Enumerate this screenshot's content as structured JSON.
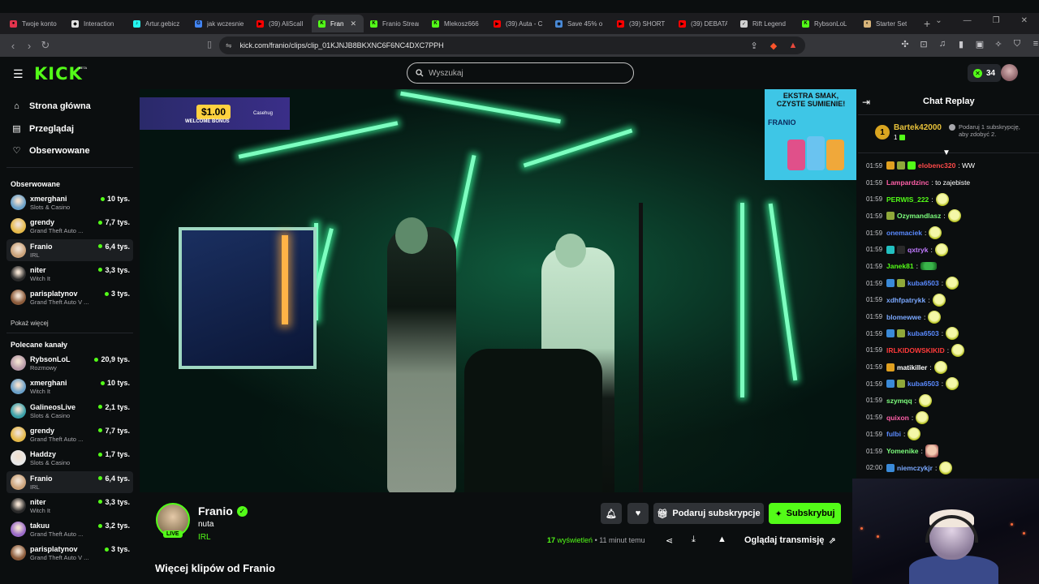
{
  "tabs": [
    {
      "title": "Twoje konto",
      "color": "#e2344d",
      "glyph": "●",
      "active": false
    },
    {
      "title": "Interaction",
      "color": "#e0e0e0",
      "glyph": "◆",
      "active": false
    },
    {
      "title": "Artur.gebicz",
      "color": "#25f4ee",
      "glyph": "♪",
      "active": false
    },
    {
      "title": "jak wczesnie",
      "color": "#4285f4",
      "glyph": "G",
      "active": false
    },
    {
      "title": "(39) AliScall",
      "color": "#ff0000",
      "glyph": "▶",
      "active": false
    },
    {
      "title": "Fran",
      "color": "#53fc18",
      "glyph": "K",
      "active": true
    },
    {
      "title": "Franio Stream",
      "color": "#53fc18",
      "glyph": "K",
      "active": false
    },
    {
      "title": "Mlekosz666",
      "color": "#53fc18",
      "glyph": "K",
      "active": false
    },
    {
      "title": "(39) Auta - C",
      "color": "#ff0000",
      "glyph": "▶",
      "active": false
    },
    {
      "title": "Save 45% o",
      "color": "#4a8ad8",
      "glyph": "◉",
      "active": false
    },
    {
      "title": "(39) SHORT",
      "color": "#ff0000",
      "glyph": "▶",
      "active": false
    },
    {
      "title": "(39) DEBATA",
      "color": "#ff0000",
      "glyph": "▶",
      "active": false
    },
    {
      "title": "Rift Legend",
      "color": "#d0d0d0",
      "glyph": "✓",
      "active": false
    },
    {
      "title": "RybsonLoL",
      "color": "#53fc18",
      "glyph": "K",
      "active": false
    },
    {
      "title": "Starter Set",
      "color": "#d7b47a",
      "glyph": "◐",
      "active": false
    }
  ],
  "address_bar": {
    "url": "kick.com/franio/clips/clip_01KJNJB8BKXNC6F6NC4DXC7PPH"
  },
  "header": {
    "logo": "KICK",
    "logo_badge": "BETA",
    "search_placeholder": "Wyszukaj",
    "kicks_count": "34"
  },
  "sidebar": {
    "nav": [
      {
        "label": "Strona główna",
        "icon": "home-icon"
      },
      {
        "label": "Przeglądaj",
        "icon": "browse-icon"
      },
      {
        "label": "Obserwowane",
        "icon": "heart-icon"
      }
    ],
    "followed_heading": "Obserwowane",
    "followed": [
      {
        "name": "xmerghani",
        "category": "Slots & Casino",
        "viewers": "10 tys.",
        "avatar": "#6aa0c8",
        "selected": false
      },
      {
        "name": "grendy",
        "category": "Grand Theft Auto ...",
        "viewers": "7,7 tys.",
        "avatar": "#e5b94a",
        "selected": false
      },
      {
        "name": "Franio",
        "category": "IRL",
        "viewers": "6,4 tys.",
        "avatar": "#caa27a",
        "selected": true
      },
      {
        "name": "niter",
        "category": "Witch It",
        "viewers": "3,3 tys.",
        "avatar": "#2a2a2a",
        "selected": false
      },
      {
        "name": "parisplatynov",
        "category": "Grand Theft Auto V ...",
        "viewers": "3 tys.",
        "avatar": "#8a5a3a",
        "selected": false
      }
    ],
    "show_more": "Pokaż więcej",
    "recommended_heading": "Polecane kanały",
    "recommended": [
      {
        "name": "RybsonLoL",
        "category": "Rozmowy",
        "viewers": "20,9 tys.",
        "avatar": "#b89aa8",
        "selected": false
      },
      {
        "name": "xmerghani",
        "category": "Witch It",
        "viewers": "10 tys.",
        "avatar": "#6aa0c8",
        "selected": false
      },
      {
        "name": "GalineosLive",
        "category": "Slots & Casino",
        "viewers": "2,1 tys.",
        "avatar": "#3aa0a8",
        "selected": false
      },
      {
        "name": "grendy",
        "category": "Grand Theft Auto ...",
        "viewers": "7,7 tys.",
        "avatar": "#e5b94a",
        "selected": false
      },
      {
        "name": "Haddzy",
        "category": "Slots & Casino",
        "viewers": "1,7 tys.",
        "avatar": "#e8e8e8",
        "selected": false
      },
      {
        "name": "Franio",
        "category": "IRL",
        "viewers": "6,4 tys.",
        "avatar": "#caa27a",
        "selected": true
      },
      {
        "name": "niter",
        "category": "Witch It",
        "viewers": "3,3 tys.",
        "avatar": "#2a2a2a",
        "selected": false
      },
      {
        "name": "takuu",
        "category": "Grand Theft Auto ...",
        "viewers": "3,2 tys.",
        "avatar": "#9a6ac8",
        "selected": false
      },
      {
        "name": "parisplatynov",
        "category": "Grand Theft Auto V ...",
        "viewers": "3 tys.",
        "avatar": "#8a5a3a",
        "selected": false
      }
    ]
  },
  "video": {
    "ad_left_amount": "$1.00",
    "ad_left_text": "WELCOME BONUS",
    "ad_left_brand": "Casehug",
    "ad_right_slogan": "EKSTRA SMAK, CZYSTE SUMIENIE!",
    "ad_right_name": "FRANIO"
  },
  "clip_info": {
    "streamer": "Franio",
    "live_badge": "LIVE",
    "title": "nuta",
    "category": "IRL",
    "views_count": "17",
    "views_word": "wyświetleń",
    "time_ago": "• 11 minut temu",
    "gift_sub_label": "Podaruj subskrypcje",
    "subscribe_label": "Subskrybuj",
    "watch_label": "Oglądaj transmisję",
    "more_clips": "Więcej klipów od Franio"
  },
  "chat": {
    "title": "Chat Replay",
    "top_gifter": {
      "rank": "1",
      "name": "Bartek42000",
      "count": "1"
    },
    "gift_prompt": "Podaruj 1 subskrypcję, aby zdobyć 2.",
    "messages": [
      {
        "time": "01:59",
        "user": "elobenc320",
        "color": "#ff4a4a",
        "badges": [
          "#e0a020",
          "#8fa83a",
          "#53fc18"
        ],
        "text": ": WW",
        "emotes": 0,
        "emote": "skull"
      },
      {
        "time": "01:59",
        "user": "Lampardzinc",
        "color": "#ff5fa8",
        "badges": [],
        "text": ": to zajebiste",
        "emotes": 0,
        "emote": "skull"
      },
      {
        "time": "01:59",
        "user": "PERWIS_222",
        "color": "#53fc18",
        "badges": [],
        "text": ":",
        "emotes": 1,
        "emote": "skull"
      },
      {
        "time": "01:59",
        "user": "Ozymandlasz",
        "color": "#7dff7d",
        "badges": [
          "#8fa83a"
        ],
        "text": ":",
        "emotes": 1,
        "emote": "skull"
      },
      {
        "time": "01:59",
        "user": "onemaciek",
        "color": "#5a8aff",
        "badges": [],
        "text": ":",
        "emotes": 1,
        "emote": "skull"
      },
      {
        "time": "01:59",
        "user": "qxtryk",
        "color": "#c07aff",
        "badges": [
          "#22c0c0",
          "#2a2a2a"
        ],
        "text": ":",
        "emotes": 1,
        "emote": "skull"
      },
      {
        "time": "01:59",
        "user": "Janek81",
        "color": "#53fc18",
        "badges": [],
        "text": ":",
        "emotes": 1,
        "emote": "frog"
      },
      {
        "time": "01:59",
        "user": "kuba6503",
        "color": "#5a8aff",
        "badges": [
          "#3a8ad8",
          "#8fa83a"
        ],
        "text": ":",
        "emotes": 1,
        "emote": "skull"
      },
      {
        "time": "01:59",
        "user": "xdhfpatrykk",
        "color": "#7aa8ff",
        "badges": [],
        "text": ":",
        "emotes": 1,
        "emote": "skull"
      },
      {
        "time": "01:59",
        "user": "blomewwe",
        "color": "#7aa8ff",
        "badges": [],
        "text": ":",
        "emotes": 1,
        "emote": "skull"
      },
      {
        "time": "01:59",
        "user": "kuba6503",
        "color": "#5a8aff",
        "badges": [
          "#3a8ad8",
          "#8fa83a"
        ],
        "text": ":",
        "emotes": 1,
        "emote": "skull"
      },
      {
        "time": "01:59",
        "user": "IRLKIDOWSKIKID",
        "color": "#ff3a3a",
        "badges": [],
        "text": ":",
        "emotes": 1,
        "emote": "skull"
      },
      {
        "time": "01:59",
        "user": "matikiller",
        "color": "#ffffff",
        "badges": [
          "#e0a020"
        ],
        "text": ":",
        "emotes": 1,
        "emote": "skull"
      },
      {
        "time": "01:59",
        "user": "kuba6503",
        "color": "#5a8aff",
        "badges": [
          "#3a8ad8",
          "#8fa83a"
        ],
        "text": ":",
        "emotes": 1,
        "emote": "skull"
      },
      {
        "time": "01:59",
        "user": "szymqq",
        "color": "#7dff7d",
        "badges": [],
        "text": ":",
        "emotes": 1,
        "emote": "skull"
      },
      {
        "time": "01:59",
        "user": "quixon",
        "color": "#ff5fa8",
        "badges": [],
        "text": ":",
        "emotes": 1,
        "emote": "skull"
      },
      {
        "time": "01:59",
        "user": "fulbi",
        "color": "#5a8aff",
        "badges": [],
        "text": ":",
        "emotes": 1,
        "emote": "skull"
      },
      {
        "time": "01:59",
        "user": "Yomenike",
        "color": "#7dff7d",
        "badges": [],
        "text": ":",
        "emotes": 1,
        "emote": "face"
      },
      {
        "time": "02:00",
        "user": "niemczykjr",
        "color": "#7aa8ff",
        "badges": [
          "#3a8ad8"
        ],
        "text": ":",
        "emotes": 1,
        "emote": "skull"
      }
    ]
  },
  "colors": {
    "brand": "#53fc18",
    "bg": "#0b0e0f"
  }
}
